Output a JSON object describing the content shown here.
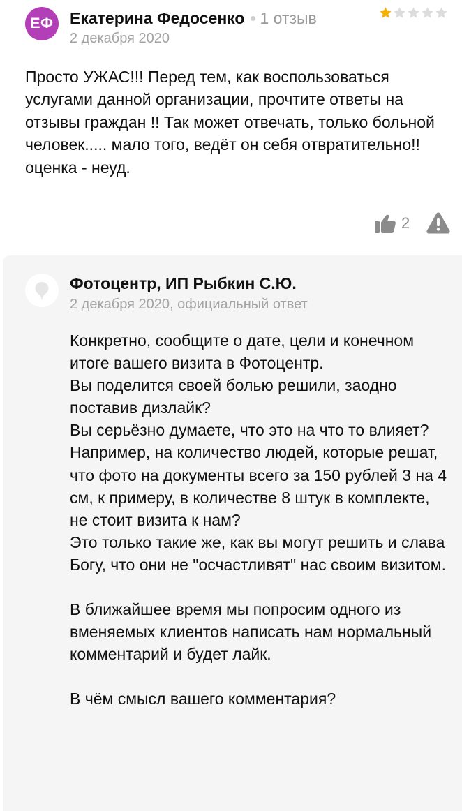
{
  "review": {
    "avatar_initials": "ЕФ",
    "avatar_color": "#b23fb7",
    "author": "Екатерина Федосенко",
    "review_count": "1 отзыв",
    "rating": 1,
    "rating_max": 5,
    "star_color_filled": "#f6b100",
    "star_color_empty": "#dcdcdc",
    "date": "2 декабря 2020",
    "text": "Просто УЖАС!!! Перед тем, как воспользоваться услугами данной организации, прочтите ответы на отзывы граждан !! Так может отвечать, только больной человек..... мало того, ведёт он себя отвратительно!! оценка - неуд.",
    "likes": "2",
    "like_icon": "thumb-up-icon",
    "report_icon": "warning-icon"
  },
  "reply": {
    "org_name": "Фотоцентр, ИП Рыбкин С.Ю.",
    "meta": "2 декабря 2020, официальный ответ",
    "background": "#f5f5f5",
    "paragraphs": [
      "Конкретно, сообщите о дате, цели и конечном итоге вашего визита в Фотоцентр.",
      "Вы поделится своей болью решили, заодно поставив дизлайк?",
      "Вы серьёзно думаете, что это на что то влияет?",
      "Например, на количество людей, которые решат, что фото на документы всего за 150 рублей 3 на 4 см, к примеру, в количестве 8 штук в комплекте, не стоит визита к нам?",
      "Это только такие же, как вы могут решить и слава Богу, что они не \"осчастливят\" нас своим визитом.",
      "В ближайшее время мы попросим одного из вменяемых клиентов написать нам нормальный комментарий и будет лайк.",
      "В чём смысл вашего комментария?"
    ]
  }
}
